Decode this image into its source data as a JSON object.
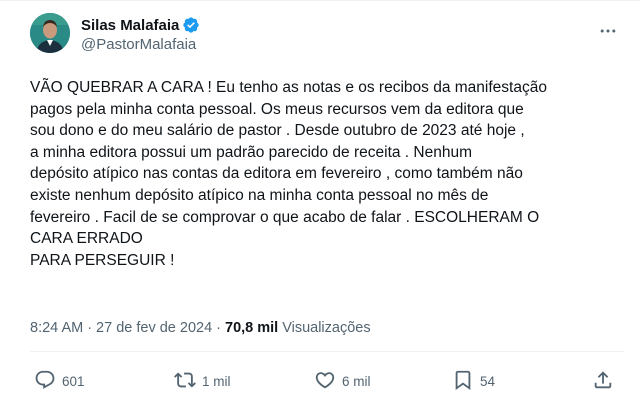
{
  "author": {
    "display_name": "Silas Malafaia",
    "handle": "@PastorMalafaia",
    "verified": true
  },
  "tweet": {
    "text": "VÃO QUEBRAR A CARA ! Eu tenho as notas e os recibos da manifestação\npagos pela minha conta pessoal. Os meus recursos vem da editora que\nsou dono e do meu salário de pastor . Desde outubro de 2023 até hoje ,\n a minha editora possui um padrão parecido de receita . Nenhum\ndepósito atípico nas contas da editora em fevereiro , como também não\nexiste nenhum depósito atípico na minha conta pessoal no mês de\nfevereiro . Facil de se comprovar o que acabo de falar . ESCOLHERAM O\nCARA ERRADO\nPARA PERSEGUIR !",
    "time": "8:24 AM",
    "separator": "·",
    "date": "27 de fev de 2024",
    "views_count": "70,8 mil",
    "views_label": "Visualizações"
  },
  "actions": {
    "replies": "601",
    "retweets": "1 mil",
    "likes": "6 mil",
    "bookmarks": "54"
  },
  "icons": {
    "verified": "verified-badge-icon",
    "more": "more-dots-icon",
    "reply": "reply-icon",
    "retweet": "retweet-icon",
    "like": "heart-icon",
    "bookmark": "bookmark-icon",
    "share": "share-icon"
  },
  "colors": {
    "verified": "#1d9bf0",
    "text": "#0f1419",
    "muted": "#536471",
    "divider": "#eff3f4"
  }
}
